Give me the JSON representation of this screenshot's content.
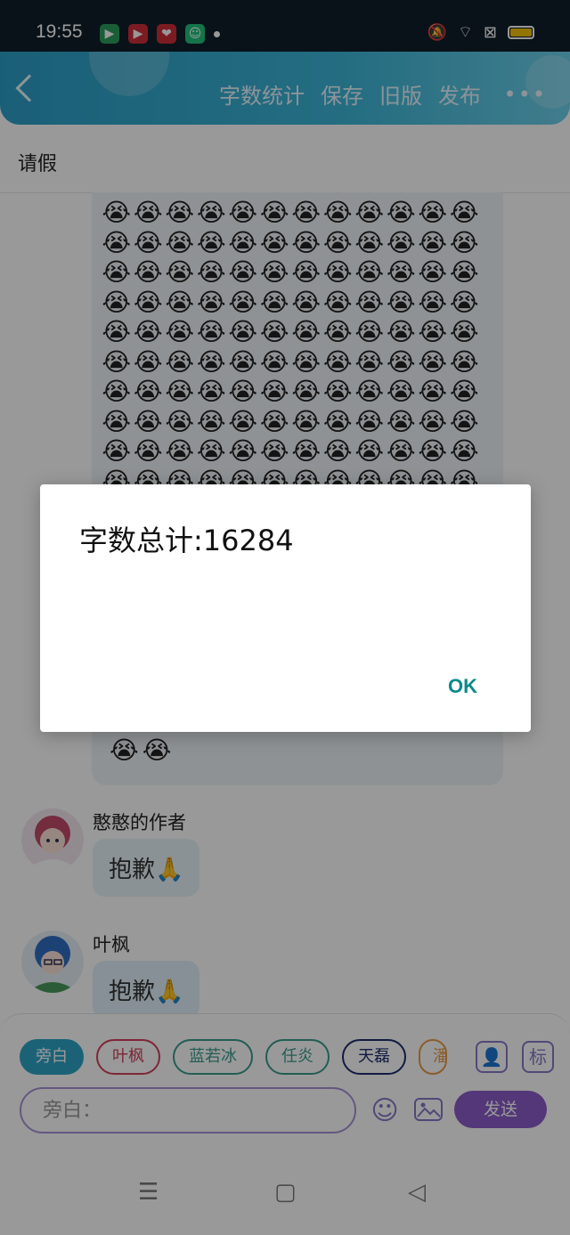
{
  "status_bar": {
    "time": "19:55",
    "apps": [
      {
        "name": "video-app-icon",
        "glyph": "▶",
        "color": "#2a9d5a"
      },
      {
        "name": "player-app-icon",
        "glyph": "▶",
        "color": "#d12d3a"
      },
      {
        "name": "heart-app-icon",
        "glyph": "❤",
        "color": "#d12d3a"
      },
      {
        "name": "android-app-icon",
        "glyph": "☺",
        "color": "#22c17a"
      }
    ]
  },
  "header": {
    "actions": [
      "字数统计",
      "保存",
      "旧版",
      "发布"
    ],
    "more": "•••"
  },
  "title": "请假",
  "messages": [
    {
      "name": "憨憨的作者",
      "text": "抱歉🙏"
    },
    {
      "name": "叶枫",
      "text": "抱歉🙏"
    }
  ],
  "emoji": "😭",
  "composer": {
    "characters": [
      "旁白",
      "叶枫",
      "蓝若冰",
      "任炎",
      "天磊",
      "潘"
    ],
    "placeholder": "旁白：",
    "role_button": "标",
    "send_label": "发送"
  },
  "dialog": {
    "message": "字数总计:16284",
    "ok_label": "OK"
  }
}
